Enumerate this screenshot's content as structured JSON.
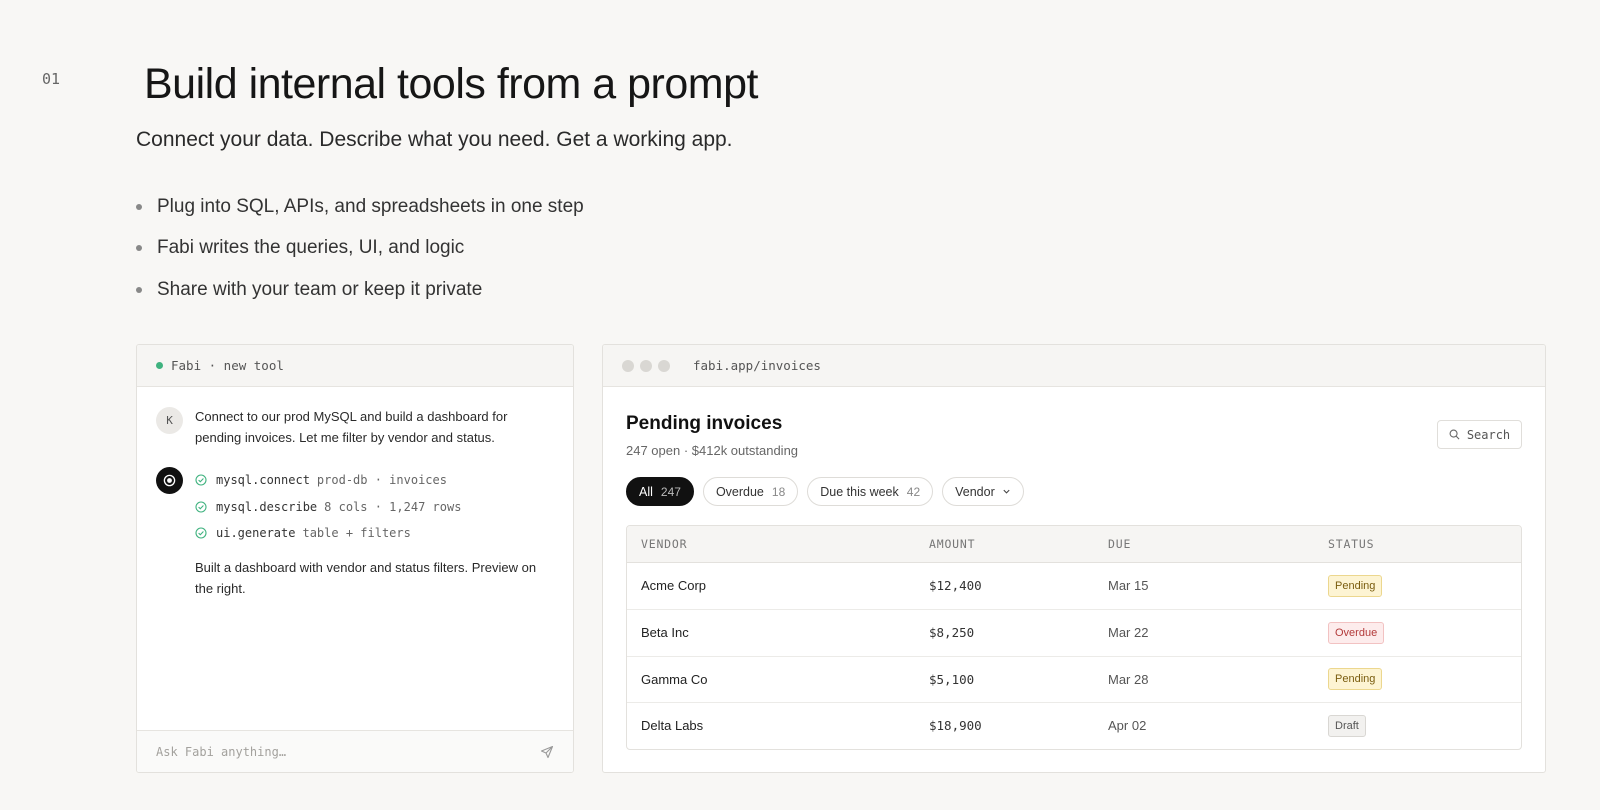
{
  "section_number": "01",
  "headline": "Build internal tools from a prompt",
  "subhead": "Connect your data. Describe what you need. Get a working app.",
  "bullets": [
    "Plug into SQL, APIs, and spreadsheets in one step",
    "Fabi writes the queries, UI, and logic",
    "Share with your team or keep it private"
  ],
  "chat": {
    "header": "Fabi · new tool",
    "status_color": "#3fb27f",
    "user_initial": "K",
    "user_message": "Connect to our prod MySQL and build a dashboard for pending invoices. Let me filter by vendor and status.",
    "tool_calls": [
      {
        "name": "mysql.connect",
        "args": "prod-db · invoices"
      },
      {
        "name": "mysql.describe",
        "args": "8 cols · 1,247 rows"
      },
      {
        "name": "ui.generate",
        "args": "table + filters"
      }
    ],
    "bot_summary": "Built a dashboard with vendor and status filters. Preview on the right.",
    "input_placeholder": "Ask Fabi anything…"
  },
  "app": {
    "url": "fabi.app/invoices",
    "title": "Pending invoices",
    "subtitle": "247 open · $412k outstanding",
    "search_label": "Search",
    "filters": [
      {
        "label": "All",
        "count": "247"
      },
      {
        "label": "Overdue",
        "count": "18"
      },
      {
        "label": "Due this week",
        "count": "42"
      },
      {
        "label": "Vendor",
        "count": ""
      }
    ],
    "columns": [
      "VENDOR",
      "AMOUNT",
      "DUE",
      "STATUS"
    ],
    "rows": [
      {
        "vendor": "Acme Corp",
        "amount": "$12,400",
        "due": "Mar 15",
        "status": "Pending"
      },
      {
        "vendor": "Beta Inc",
        "amount": "$8,250",
        "due": "Mar 22",
        "status": "Overdue"
      },
      {
        "vendor": "Gamma Co",
        "amount": "$5,100",
        "due": "Mar 28",
        "status": "Pending"
      },
      {
        "vendor": "Delta Labs",
        "amount": "$18,900",
        "due": "Apr 02",
        "status": "Draft"
      }
    ]
  }
}
